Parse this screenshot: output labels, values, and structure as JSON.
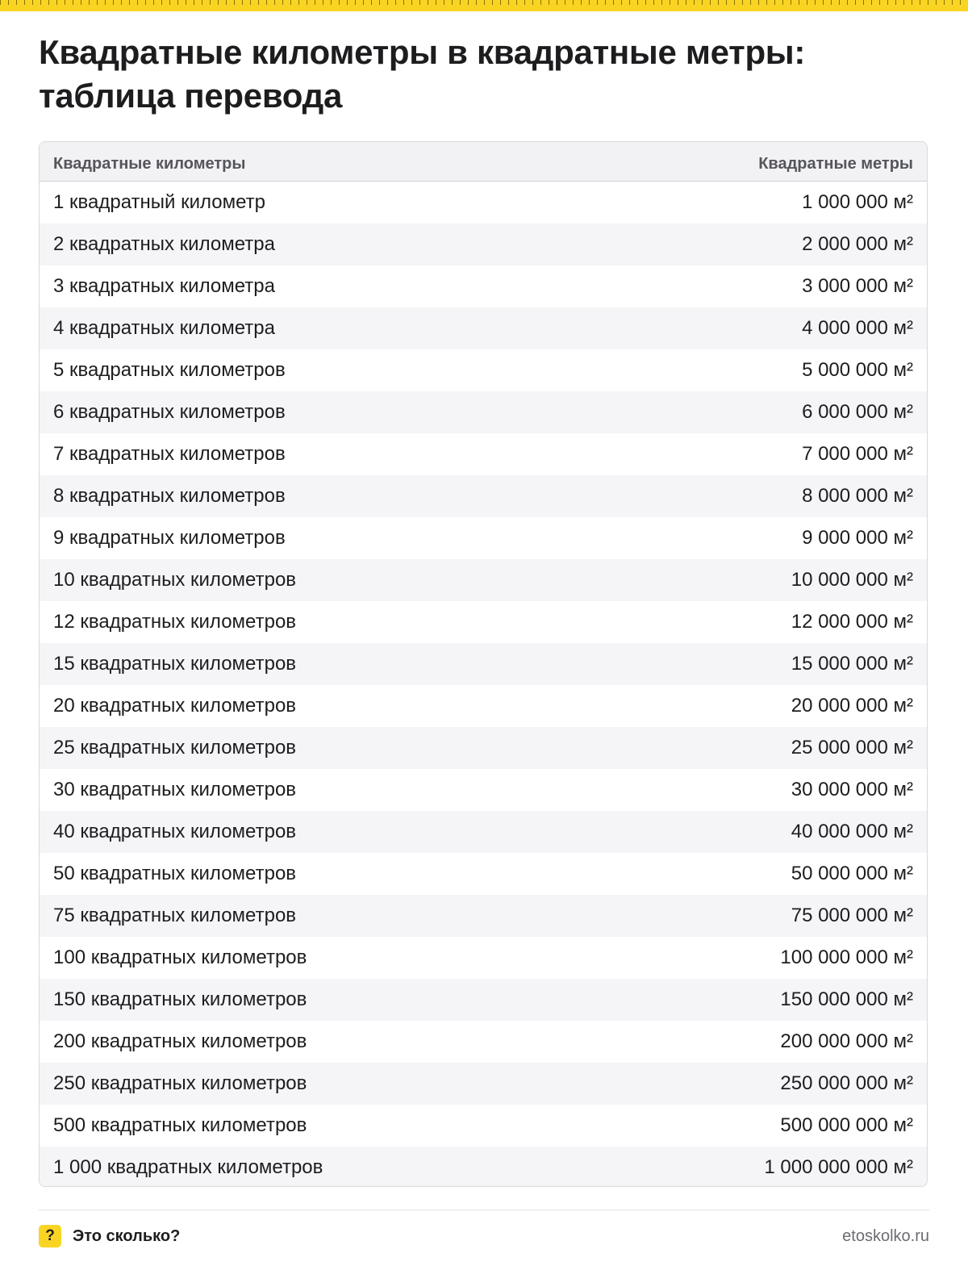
{
  "title": "Квадратные километры в квадратные метры: таблица перевода",
  "table": {
    "headers": [
      "Квадратные километры",
      "Квадратные метры"
    ],
    "rows": [
      [
        "1 квадратный километр",
        "1 000 000 м²"
      ],
      [
        "2 квадратных километра",
        "2 000 000 м²"
      ],
      [
        "3 квадратных километра",
        "3 000 000 м²"
      ],
      [
        "4 квадратных километра",
        "4 000 000 м²"
      ],
      [
        "5 квадратных километров",
        "5 000 000 м²"
      ],
      [
        "6 квадратных километров",
        "6 000 000 м²"
      ],
      [
        "7 квадратных километров",
        "7 000 000 м²"
      ],
      [
        "8 квадратных километров",
        "8 000 000 м²"
      ],
      [
        "9 квадратных километров",
        "9 000 000 м²"
      ],
      [
        "10 квадратных километров",
        "10 000 000 м²"
      ],
      [
        "12 квадратных километров",
        "12 000 000 м²"
      ],
      [
        "15 квадратных километров",
        "15 000 000 м²"
      ],
      [
        "20 квадратных километров",
        "20 000 000 м²"
      ],
      [
        "25 квадратных километров",
        "25 000 000 м²"
      ],
      [
        "30 квадратных километров",
        "30 000 000 м²"
      ],
      [
        "40 квадратных километров",
        "40 000 000 м²"
      ],
      [
        "50 квадратных километров",
        "50 000 000 м²"
      ],
      [
        "75 квадратных километров",
        "75 000 000 м²"
      ],
      [
        "100 квадратных километров",
        "100 000 000 м²"
      ],
      [
        "150 квадратных километров",
        "150 000 000 м²"
      ],
      [
        "200 квадратных километров",
        "200 000 000 м²"
      ],
      [
        "250 квадратных километров",
        "250 000 000 м²"
      ],
      [
        "500 квадратных километров",
        "500 000 000 м²"
      ],
      [
        "1 000 квадратных километров",
        "1 000 000 000 м²"
      ]
    ]
  },
  "footer": {
    "icon_glyph": "?",
    "icon_name": "question-mark-icon",
    "brand": "Это сколько?",
    "site": "etoskolko.ru"
  },
  "colors": {
    "accent": "#f9d423",
    "text": "#1d1d1f",
    "header_text": "#55565c",
    "row_stripe": "#f5f5f7",
    "border": "#d9d9de"
  }
}
